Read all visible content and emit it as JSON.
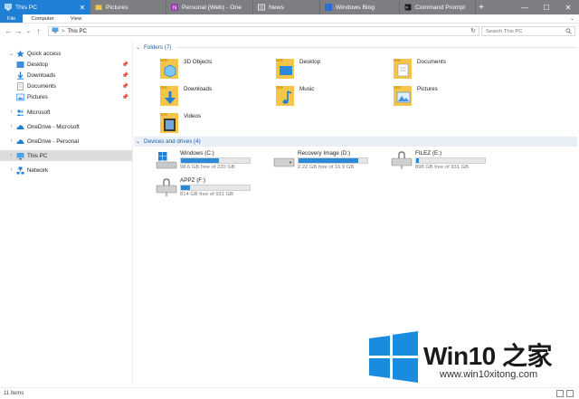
{
  "colors": {
    "accent": "#1e7fd4",
    "tabbar": "#7d7f82",
    "folder": "#f3c54b",
    "drive_fill": "#2a8ad8"
  },
  "tabs": [
    {
      "label": "This PC",
      "icon": "this-pc-icon",
      "active": true
    },
    {
      "label": "Pictures",
      "icon": "folder-icon",
      "active": false
    },
    {
      "label": "Personal (Web) - One",
      "icon": "onenote-icon",
      "active": false
    },
    {
      "label": "News",
      "icon": "news-icon",
      "active": false
    },
    {
      "label": "Windows Blog",
      "icon": "edge-icon",
      "active": false
    },
    {
      "label": "Command Prompt",
      "icon": "cmd-icon",
      "active": false
    }
  ],
  "window_controls": {
    "new_tab": "+",
    "minimize": "—",
    "maximize": "☐",
    "close": "✕"
  },
  "ribbon": {
    "file": "File",
    "computer": "Computer",
    "view": "View",
    "expand": "⌄"
  },
  "nav_buttons": {
    "back": "←",
    "forward": "→",
    "recent": "⌄",
    "up": "↑"
  },
  "address": {
    "path": "This PC",
    "chevron": ">",
    "refresh": "↻"
  },
  "search": {
    "placeholder": "Search This PC"
  },
  "sidebar": {
    "quick_access": "Quick access",
    "items": [
      {
        "label": "Desktop"
      },
      {
        "label": "Downloads"
      },
      {
        "label": "Documents"
      },
      {
        "label": "Pictures"
      }
    ],
    "microsoft": "Microsoft",
    "onedrive_microsoft": "OneDrive - Microsoft",
    "onedrive_personal": "OneDrive - Personal",
    "this_pc": "This PC",
    "network": "Network"
  },
  "folders_section": {
    "title": "Folders (7)"
  },
  "folders": [
    {
      "label": "3D Objects"
    },
    {
      "label": "Desktop"
    },
    {
      "label": "Documents"
    },
    {
      "label": "Downloads"
    },
    {
      "label": "Music"
    },
    {
      "label": "Pictures"
    },
    {
      "label": "Videos"
    }
  ],
  "drives_section": {
    "title": "Devices and drives (4)"
  },
  "drives": [
    {
      "name": "Windows (C:)",
      "free": "98.6 GB free of 220 GB",
      "used_fraction": 0.55
    },
    {
      "name": "Recovery Image (D:)",
      "free": "2.22 GB free of 16.9 GB",
      "used_fraction": 0.87
    },
    {
      "name": "FILEZ (E:)",
      "free": "898 GB free of 931 GB",
      "used_fraction": 0.04
    },
    {
      "name": "APPZ (F:)",
      "free": "814 GB free of 931 GB",
      "used_fraction": 0.13
    }
  ],
  "status": {
    "count": "11 items"
  },
  "watermark": {
    "brand": "Win10 之家",
    "url": "www.win10xitong.com"
  }
}
